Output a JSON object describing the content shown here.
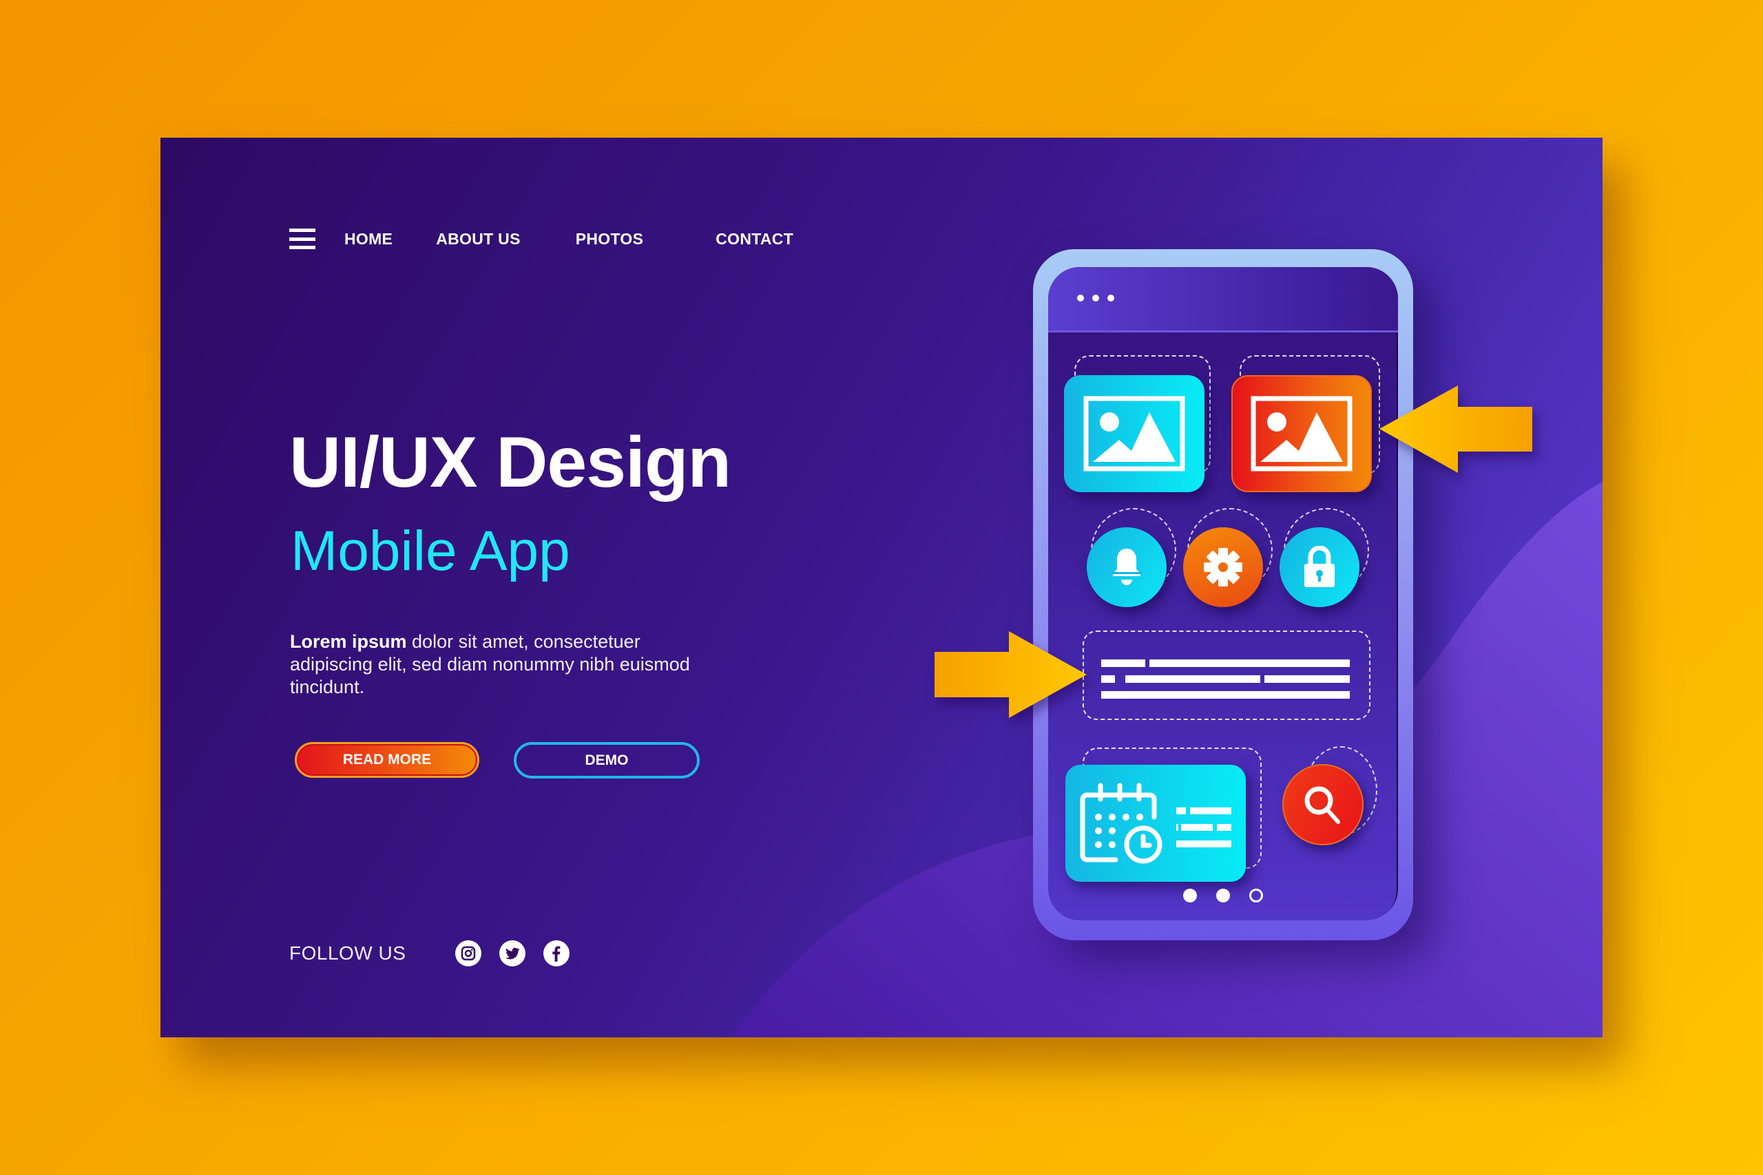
{
  "nav": {
    "menu_icon": "hamburger-menu-icon",
    "items": [
      {
        "label": "HOME"
      },
      {
        "label": "ABOUT US"
      },
      {
        "label": "PHOTOS"
      },
      {
        "label": "CONTACT"
      }
    ]
  },
  "hero": {
    "title": "UI/UX Design",
    "subtitle": "Mobile App",
    "description_bold": "Lorem ipsum",
    "description_rest": " dolor sit amet, consectetuer adipiscing elit, sed diam nonummy nibh euismod tincidunt.",
    "read_more_label": "READ MORE",
    "demo_label": "DEMO"
  },
  "social": {
    "follow_label": "FOLLOW US",
    "icons": [
      "instagram-icon",
      "twitter-icon",
      "facebook-icon"
    ]
  },
  "phone": {
    "header_icon": "more-dots-icon",
    "tiles": [
      {
        "icon": "image-icon",
        "color": "cyan"
      },
      {
        "icon": "image-icon",
        "color": "red"
      }
    ],
    "circle_buttons": [
      {
        "icon": "bell-icon",
        "color": "cyan"
      },
      {
        "icon": "gear-icon",
        "color": "orange"
      },
      {
        "icon": "lock-icon",
        "color": "cyan"
      }
    ],
    "widget_icon": "calendar-clock-icon",
    "search_icon": "search-icon",
    "pager": {
      "total": 3,
      "filled": 2
    }
  },
  "colors": {
    "background": "#f7a800",
    "card_dark": "#2d0a63",
    "card_light": "#5a40d8",
    "accent_cyan": "#21e7f5",
    "accent_red": "#e5121a",
    "accent_orange": "#f3890a",
    "arrow_yellow": "#ffc000"
  }
}
